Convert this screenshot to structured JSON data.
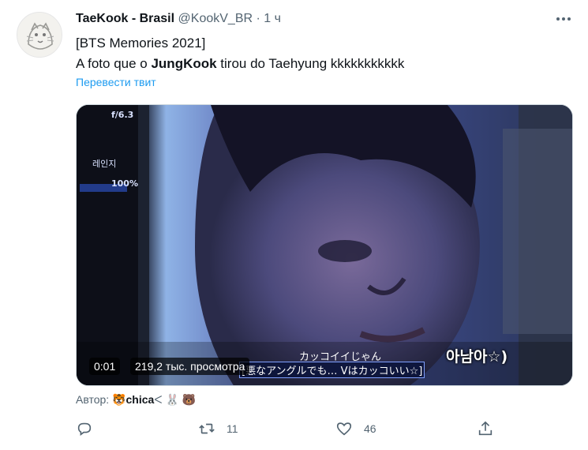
{
  "tweet": {
    "display_name": "TaeKook - Brasil",
    "handle": "@KookV_BR",
    "separator": "·",
    "time": "1 ч",
    "line1": "[BTS Memories 2021]",
    "line2_prefix": "A foto que o ",
    "line2_bold": "JungKook",
    "line2_suffix": " tirou do Taehyung kkkkkkkkkkk",
    "translate": "Перевести твит"
  },
  "video": {
    "time": "0:01",
    "views": "219,2 тыс. просмотра",
    "caption_jp_1": "カッコイイじゃん",
    "caption_jp_2": "[悪なアングルでも… Vはカッコいい☆]",
    "caption_kr": "아남아☆)",
    "camera_fstop": "f/6.3",
    "camera_mode": "레인지",
    "camera_zoom": "100%"
  },
  "attribution": {
    "label": "Автор:",
    "name": "chica"
  },
  "actions": {
    "reply_count": "",
    "retweet_count": "11",
    "like_count": "46"
  },
  "colors": {
    "link": "#1d9bf0",
    "secondary": "#536471"
  },
  "icons": [
    "more-icon",
    "reply-icon",
    "retweet-icon",
    "like-icon",
    "share-icon",
    "tiger-emoji",
    "rabbit-emoji",
    "bear-emoji"
  ]
}
